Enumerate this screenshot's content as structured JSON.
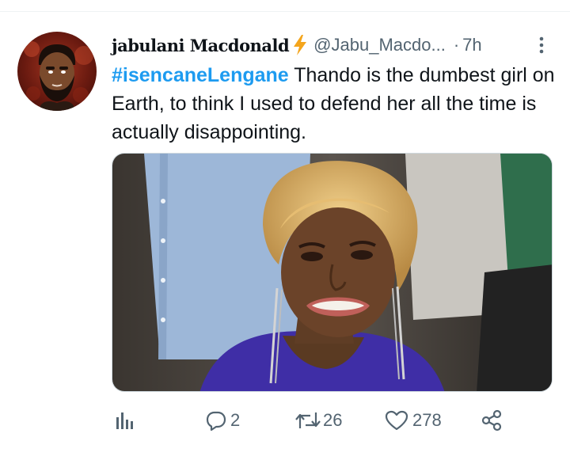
{
  "tweet": {
    "display_name": "jabulani Macdonald",
    "handle": "@Jabu_Macdo...",
    "separator": "·",
    "time": "7h",
    "hashtag": "#isencaneLengane",
    "text": "Thando is the dumbest girl on Earth, to think I used to defend her all the time is actually disappointing."
  },
  "actions": {
    "replies": "2",
    "retweets": "26",
    "likes": "278"
  },
  "icons": {
    "name_badge": "lightning-bolt-icon",
    "more": "more-vertical-icon",
    "analytics": "analytics-icon",
    "reply": "reply-icon",
    "retweet": "retweet-icon",
    "like": "heart-icon",
    "share": "share-icon"
  },
  "colors": {
    "link": "#1d9bf0",
    "secondary_text": "#536471",
    "bolt": "#f4a51c"
  }
}
